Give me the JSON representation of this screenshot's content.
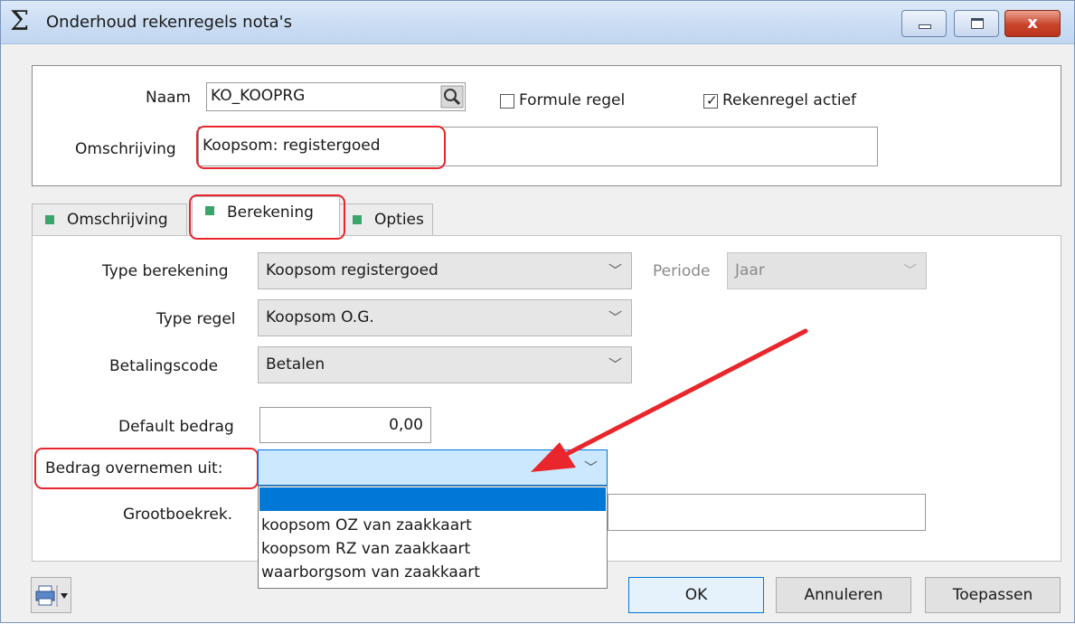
{
  "window": {
    "title": "Onderhoud rekenregels nota's",
    "title_icon": "sigma-icon",
    "close_glyph": "x"
  },
  "header": {
    "naam_label": "Naam",
    "naam_value": "KO_KOOPRG",
    "formule_label": "Formule regel",
    "formule_checked": false,
    "actief_label": "Rekenregel actief",
    "actief_checked": true,
    "omschrijving_label": "Omschrijving",
    "omschrijving_value": "Koopsom: registergoed"
  },
  "tabs": [
    {
      "label": "Omschrijving",
      "active": false
    },
    {
      "label": "Berekening",
      "active": true
    },
    {
      "label": "Opties",
      "active": false
    }
  ],
  "berekening": {
    "type_berekening_label": "Type berekening",
    "type_berekening_value": "Koopsom registergoed",
    "periode_label": "Periode",
    "periode_value": "Jaar",
    "type_regel_label": "Type regel",
    "type_regel_value": "Koopsom O.G.",
    "betalingscode_label": "Betalingscode",
    "betalingscode_value": "Betalen",
    "default_bedrag_label": "Default bedrag",
    "default_bedrag_value": "0,00",
    "bedrag_overnemen_label": "Bedrag overnemen uit:",
    "bedrag_overnemen_value": "",
    "grootboek_label": "Grootboekrek.",
    "dropdown_options": [
      "",
      "koopsom OZ van zaakkaart",
      "koopsom RZ van zaakkaart",
      "waarborgsom van zaakkaart"
    ]
  },
  "footer": {
    "ok_label": "OK",
    "cancel_label": "Annuleren",
    "apply_label": "Toepassen"
  },
  "colors": {
    "annotation_red": "#e8262b",
    "tab_marker_green": "#3aa56a",
    "selection_blue": "#0078d7"
  }
}
